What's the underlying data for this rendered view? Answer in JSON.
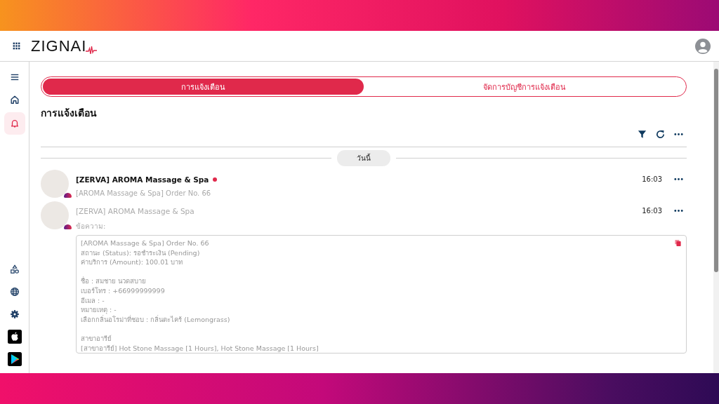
{
  "header": {
    "logo": "ZIGNAI"
  },
  "sidebar": {
    "top_items": [
      {
        "kind": "menu",
        "selected": false
      },
      {
        "kind": "home",
        "selected": false
      },
      {
        "kind": "bell",
        "selected": true
      }
    ],
    "bottom_items": [
      {
        "kind": "shapes"
      },
      {
        "kind": "globe"
      },
      {
        "kind": "gear"
      },
      {
        "kind": "apple"
      },
      {
        "kind": "play"
      }
    ]
  },
  "tabs": [
    {
      "label": "การแจ้งเตือน",
      "selected": true
    },
    {
      "label": "จัดการบัญชีการแจ้งเตือน",
      "selected": false
    }
  ],
  "page_title": "การแจ้งเตือน",
  "date_separator": "วันนี้",
  "notifications": [
    {
      "title": "[ZERVA] AROMA Massage & Spa",
      "unread": true,
      "time": "16:03",
      "expanded": false,
      "preview": "[AROMA Massage & Spa] Order No. 66"
    },
    {
      "title": "[ZERVA] AROMA Massage & Spa",
      "unread": false,
      "time": "16:03",
      "expanded": true,
      "message_label": "ข้อความ:",
      "message_blocks": [
        [
          "[AROMA Massage & Spa] Order No. 66",
          "สถานะ (Status): รอชำระเงิน (Pending)",
          "ค่าบริการ (Amount): 100.01 บาท"
        ],
        [
          "ชื่อ : สมชาย นวดสบาย",
          "เบอร์โทร : +66999999999",
          "อีเมล : -",
          "หมายเหตุ : -",
          "เลือกกลิ่นอโรม่าที่ชอบ : กลิ่นตะไคร้ (Lemongrass)"
        ],
        [
          "สาขาอารีย์",
          "[สาขาอารีย์] Hot Stone Massage [1 Hours], Hot Stone Massage [1 Hours]"
        ]
      ]
    }
  ]
}
